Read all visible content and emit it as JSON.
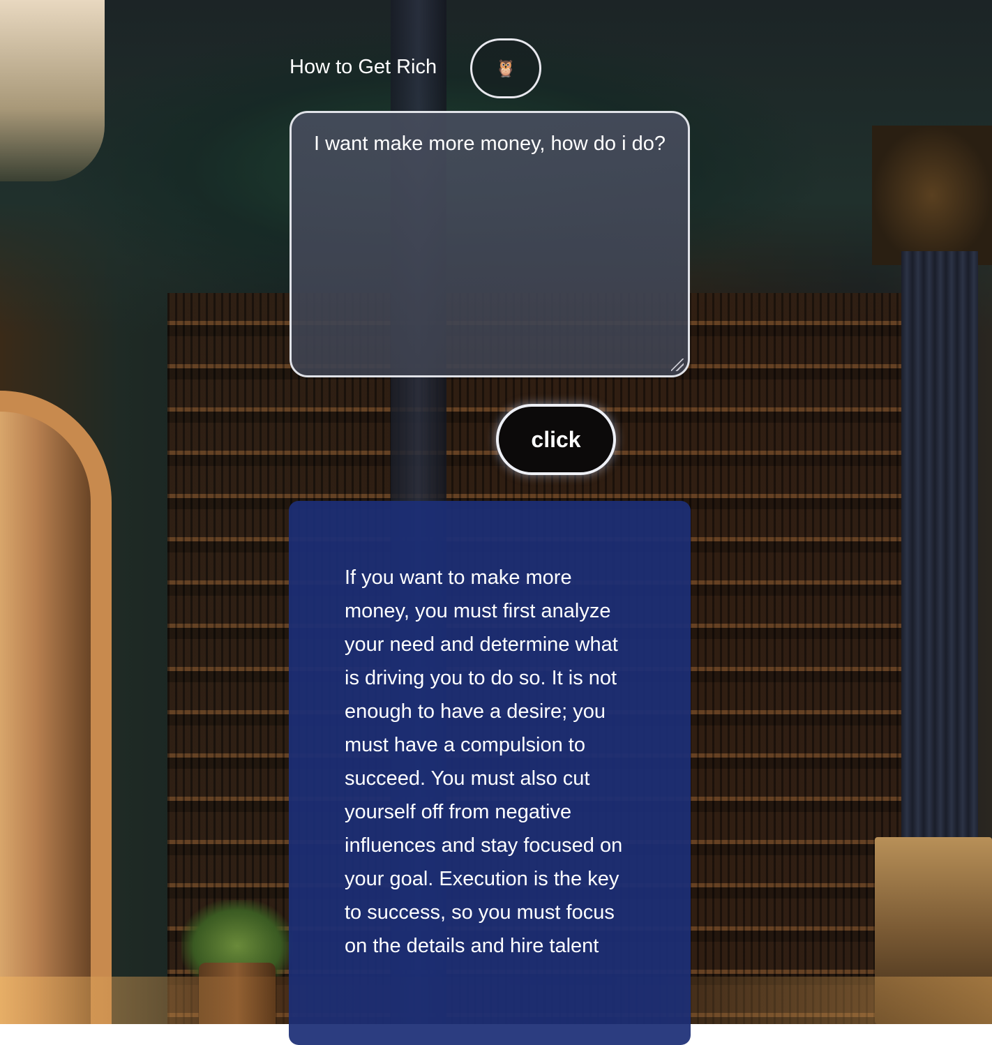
{
  "header": {
    "title": "How to Get Rich",
    "owl_button_icon": "owl-icon",
    "owl_glyph": "🦉"
  },
  "prompt": {
    "value": "I want make more money, how do i do?"
  },
  "action": {
    "button_label": "click"
  },
  "answer": {
    "text": "If you want to make more money, you must first analyze your need and determine what is driving you to do so. It is not enough to have a desire; you must have a compulsion to succeed. You must also cut yourself off from negative influences and stay focused on your goal. Execution is the key to success, so you must focus on the details and hire talent"
  },
  "colors": {
    "answer_card": "#1c2e76",
    "button_bg": "#0c0a0a",
    "border": "#e0e2e8"
  }
}
